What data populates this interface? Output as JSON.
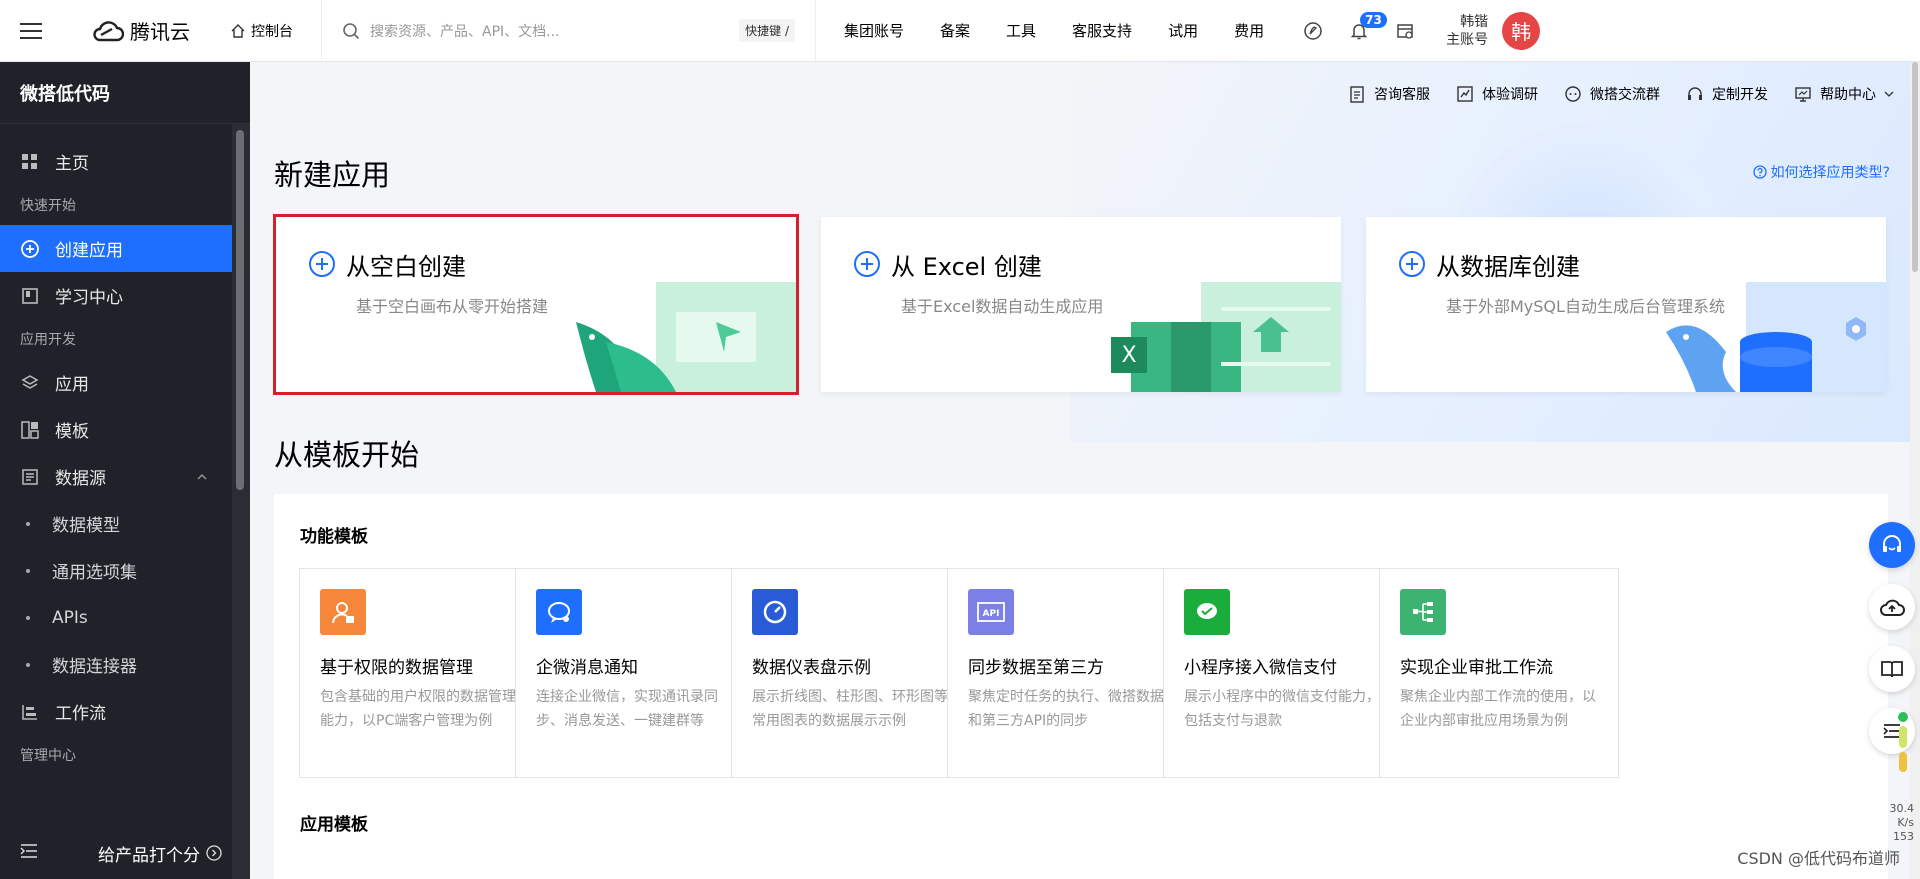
{
  "topbar": {
    "brand": "腾讯云",
    "console": "控制台",
    "search_placeholder": "搜索资源、产品、API、文档...",
    "hotkey": "快捷键 /",
    "nav": [
      "集团账号",
      "备案",
      "工具",
      "客服支持",
      "试用",
      "费用"
    ],
    "notification_count": "73",
    "user_name": "韩锴",
    "user_role": "主账号",
    "avatar_char": "韩"
  },
  "sidebar": {
    "title": "微搭低代码",
    "home": "主页",
    "group_quick": "快速开始",
    "create_app": "创建应用",
    "learn": "学习中心",
    "group_dev": "应用开发",
    "app": "应用",
    "template": "模板",
    "datasource": "数据源",
    "datasource_subs": [
      "数据模型",
      "通用选项集",
      "APIs",
      "数据连接器"
    ],
    "workflow": "工作流",
    "group_manage": "管理中心",
    "rate": "给产品打个分"
  },
  "helpbar": [
    "咨询客服",
    "体验调研",
    "微搭交流群",
    "定制开发",
    "帮助中心"
  ],
  "new_app": {
    "heading": "新建应用",
    "howto": "如何选择应用类型?",
    "cards": [
      {
        "title": "从空白创建",
        "desc": "基于空白画布从零开始搭建"
      },
      {
        "title": "从 Excel 创建",
        "desc": "基于Excel数据自动生成应用"
      },
      {
        "title": "从数据库创建",
        "desc": "基于外部MySQL自动生成后台管理系统"
      }
    ]
  },
  "templates": {
    "heading": "从模板开始",
    "func_title": "功能模板",
    "cards": [
      {
        "name": "基于权限的数据管理",
        "desc": "包含基础的用户权限的数据管理能力，以PC端客户管理为例",
        "color": "#f5873a"
      },
      {
        "name": "企微消息通知",
        "desc": "连接企业微信，实现通讯录同步、消息发送、一键建群等",
        "color": "#1f6fff"
      },
      {
        "name": "数据仪表盘示例",
        "desc": "展示折线图、柱形图、环形图等常用图表的数据展示示例",
        "color": "#2a5bd7"
      },
      {
        "name": "同步数据至第三方",
        "desc": "聚焦定时任务的执行、微搭数据和第三方API的同步",
        "color": "#7b7fe6"
      },
      {
        "name": "小程序接入微信支付",
        "desc": "展示小程序中的微信支付能力，包括支付与退款",
        "color": "#1aad3b"
      },
      {
        "name": "实现企业审批工作流",
        "desc": "聚焦企业内部工作流的使用，以企业内部审批应用场景为例",
        "color": "#3cb371"
      }
    ],
    "app_title": "应用模板"
  },
  "speed": {
    "value": "30.4",
    "unit": "K/s",
    "value2": "153"
  },
  "watermark": "CSDN @低代码布道师"
}
